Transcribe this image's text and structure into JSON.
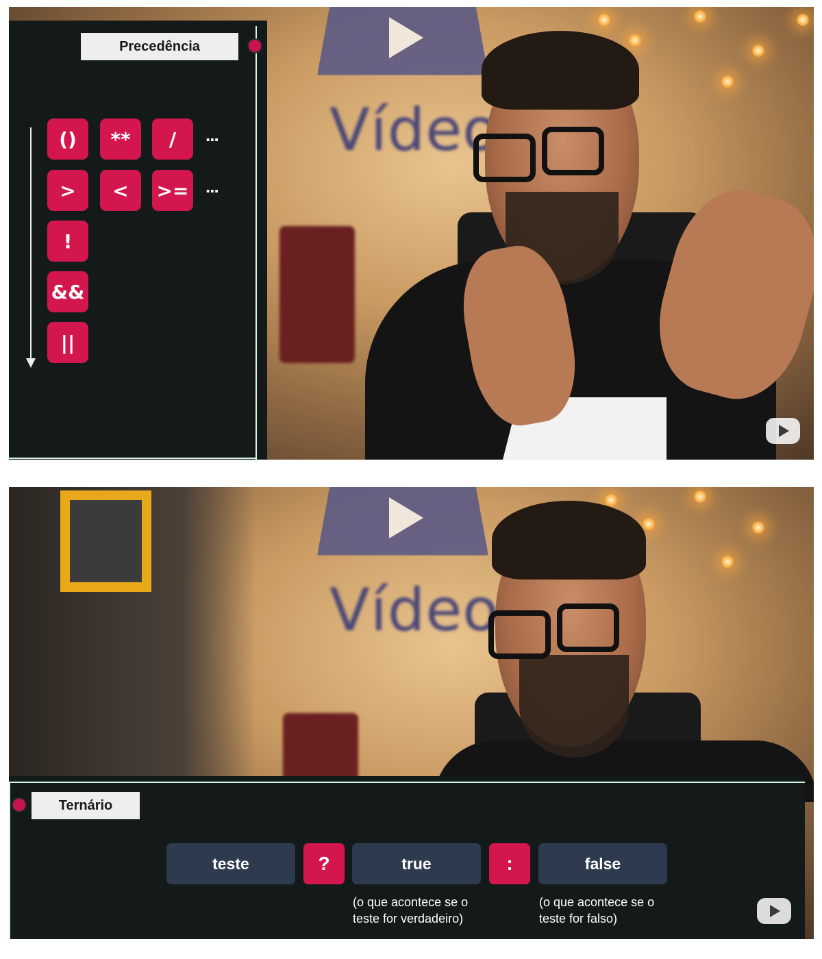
{
  "frame1": {
    "panel_title": "Precedência",
    "operator_rows": [
      {
        "ops": [
          "()",
          "**",
          "/"
        ],
        "more": "..."
      },
      {
        "ops": [
          ">",
          "<",
          ">="
        ],
        "more": "..."
      },
      {
        "ops": [
          "!"
        ]
      },
      {
        "ops": [
          "&&"
        ]
      },
      {
        "ops": [
          "||"
        ]
      }
    ],
    "wall_text": "Vídeo"
  },
  "frame2": {
    "panel_title": "Ternário",
    "parts": {
      "test": "teste",
      "question_mark": "?",
      "true_value": "true",
      "colon": ":",
      "false_value": "false"
    },
    "notes": {
      "true_note": "(o que acontece se o teste for verdadeiro)",
      "false_note": "(o que acontece se o teste for falso)"
    },
    "wall_text": "Vídeo"
  },
  "colors": {
    "accent": "#d3164d",
    "panel_bg": "#141a19",
    "outline": "#d7f5e4",
    "ternary_box": "#2e3b4e"
  },
  "icons": [
    "play-logo-icon",
    "watermark-play-icon",
    "down-arrow-icon"
  ]
}
